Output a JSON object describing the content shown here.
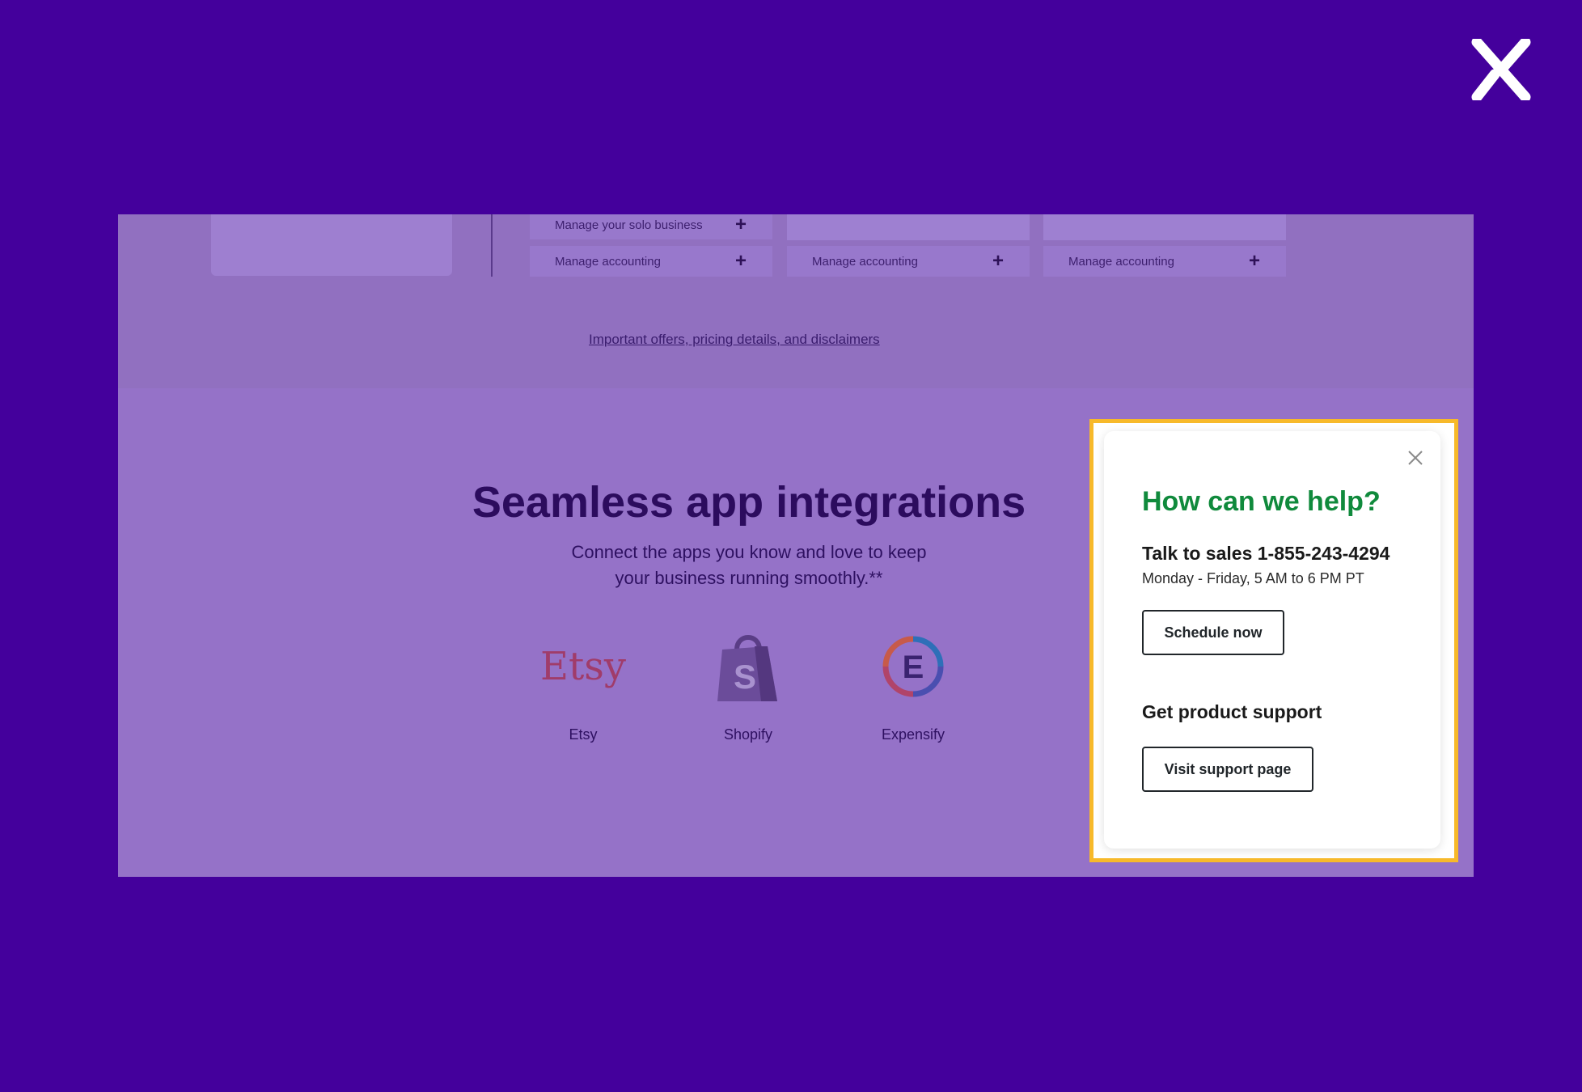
{
  "colors": {
    "background": "#44009c",
    "overlay_panel": "#9572c8",
    "highlight_border": "#f7b92a",
    "popup_title": "#108a3c"
  },
  "plans": [
    {
      "row1": "Manage your solo business",
      "row2": "Manage accounting"
    },
    {
      "row1": "",
      "row2": "Manage accounting"
    },
    {
      "row1": "",
      "row2": "Manage accounting"
    }
  ],
  "offers_link": "Important offers, pricing details, and disclaimers",
  "integrations": {
    "heading": "Seamless app integrations",
    "subtext_line1": "Connect the apps you know and love to keep",
    "subtext_line2": "your business running smoothly.**",
    "apps": [
      {
        "name": "Etsy",
        "logo_text": "Etsy",
        "icon": "etsy-logo"
      },
      {
        "name": "Shopify",
        "logo_text": "S",
        "icon": "shopify-bag-icon"
      },
      {
        "name": "Expensify",
        "logo_text": "E",
        "icon": "expensify-logo"
      }
    ]
  },
  "help_popup": {
    "title": "How can we help?",
    "sales_line": "Talk to sales 1-855-243-4294",
    "hours": "Monday - Friday, 5 AM to 6 PM PT",
    "schedule_button": "Schedule now",
    "support_title": "Get product support",
    "support_button": "Visit support page",
    "close_icon": "close-icon"
  },
  "brand_icon": "x-logo-icon"
}
